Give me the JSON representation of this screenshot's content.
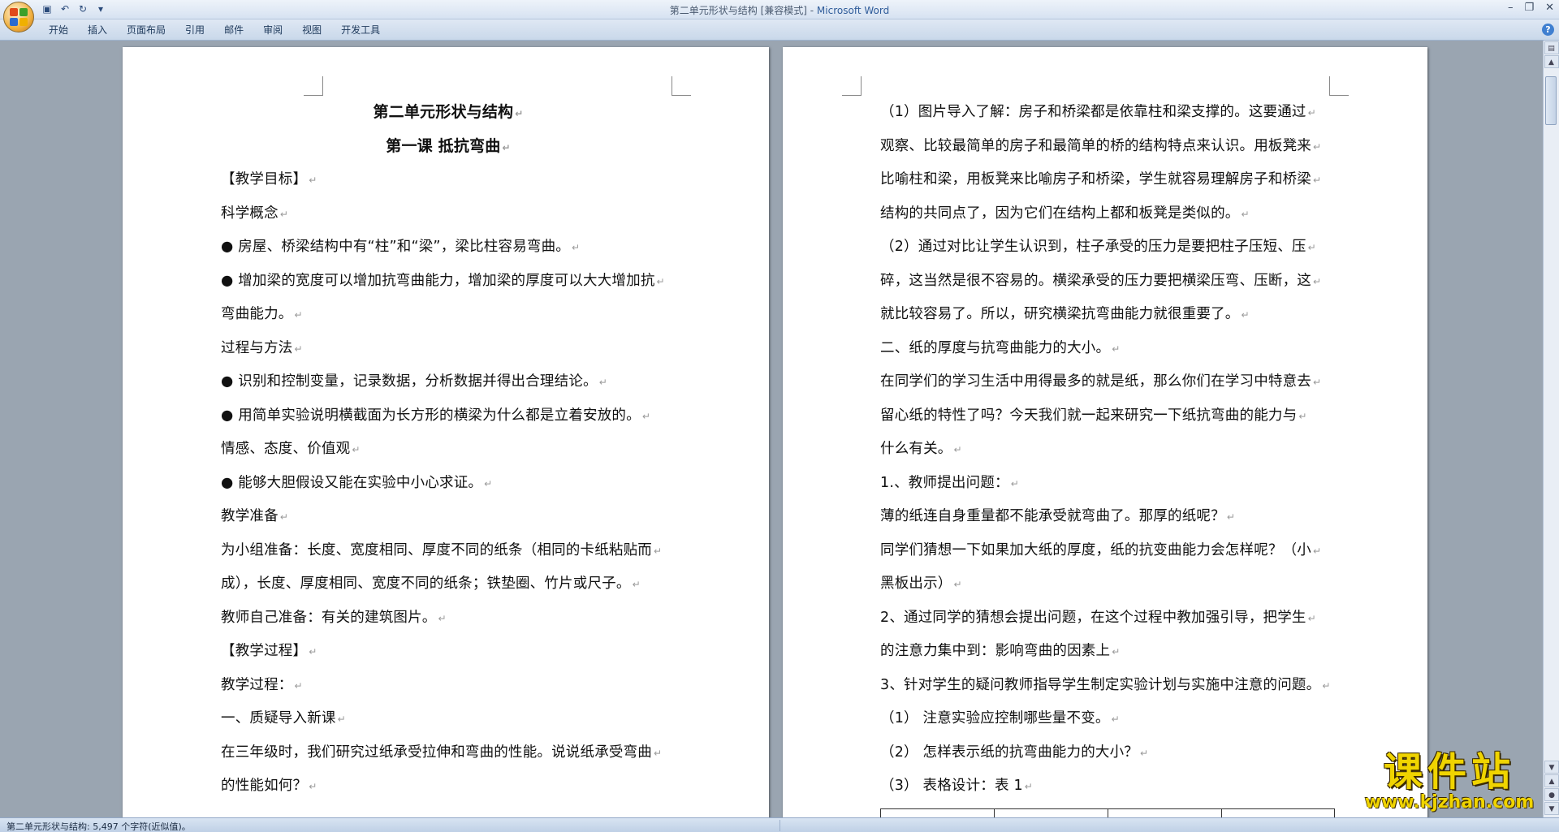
{
  "window": {
    "doc_title": "第二单元形状与结构 [兼容模式] - ",
    "app_name": "Microsoft Word"
  },
  "ribbon": {
    "tabs": [
      "开始",
      "插入",
      "页面布局",
      "引用",
      "邮件",
      "审阅",
      "视图",
      "开发工具"
    ]
  },
  "left_page": {
    "title": "第二单元形状与结构",
    "subtitle": "第一课  抵抗弯曲",
    "lines": [
      "【教学目标】",
      "科学概念",
      "●  房屋、桥梁结构中有“柱”和“梁”，梁比柱容易弯曲。",
      "●  增加梁的宽度可以增加抗弯曲能力，增加梁的厚度可以大大增加抗",
      "弯曲能力。",
      "过程与方法",
      "●  识别和控制变量，记录数据，分析数据并得出合理结论。",
      "●  用简单实验说明横截面为长方形的横梁为什么都是立着安放的。",
      "情感、态度、价值观",
      "●  能够大胆假设又能在实验中小心求证。",
      "教学准备",
      "为小组准备：长度、宽度相同、厚度不同的纸条（相同的卡纸粘贴而",
      "成），长度、厚度相同、宽度不同的纸条；铁垫圈、竹片或尺子。",
      "教师自己准备：有关的建筑图片。",
      "【教学过程】",
      "教学过程：",
      "一、质疑导入新课",
      "在三年级时，我们研究过纸承受拉伸和弯曲的性能。说说纸承受弯曲",
      "的性能如何？"
    ]
  },
  "right_page": {
    "lines": [
      "（1）图片导入了解：房子和桥梁都是依靠柱和梁支撑的。这要通过",
      "观察、比较最简单的房子和最简单的桥的结构特点来认识。用板凳来",
      "比喻柱和梁，用板凳来比喻房子和桥梁，学生就容易理解房子和桥梁",
      "结构的共同点了，因为它们在结构上都和板凳是类似的。",
      "（2）通过对比让学生认识到，柱子承受的压力是要把柱子压短、压",
      "碎，这当然是很不容易的。横梁承受的压力要把横梁压弯、压断，这",
      "就比较容易了。所以，研究横梁抗弯曲能力就很重要了。",
      "二、纸的厚度与抗弯曲能力的大小。",
      "在同学们的学习生活中用得最多的就是纸，那么你们在学习中特意去",
      "留心纸的特性了吗？今天我们就一起来研究一下纸抗弯曲的能力与",
      "什么有关。",
      "1.、教师提出问题：",
      "薄的纸连自身重量都不能承受就弯曲了。那厚的纸呢？",
      "同学们猜想一下如果加大纸的厚度，纸的抗变曲能力会怎样呢？（小",
      "黑板出示）",
      "2、通过同学的猜想会提出问题，在这个过程中教加强引导，把学生",
      "的注意力集中到：影响弯曲的因素上",
      "3、针对学生的疑问教师指导学生制定实验计划与实施中注意的问题。",
      "（1）      注意实验应控制哪些量不变。",
      "（2）      怎样表示纸的抗弯曲能力的大小？",
      "（3）      表格设计：表 1"
    ]
  },
  "status_bar": {
    "text": "第二单元形状与结构: 5,497 个字符(近似值)。"
  },
  "watermark": {
    "top": "课件站",
    "bottom": "www.kjzhan.com"
  },
  "icons": {
    "para_mark": "↵"
  }
}
